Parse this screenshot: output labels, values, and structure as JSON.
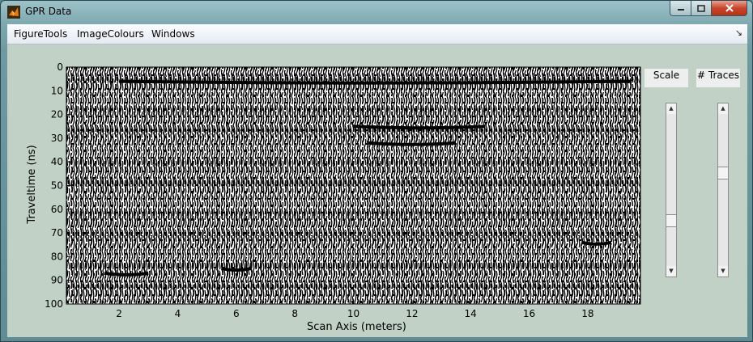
{
  "window": {
    "title": "GPR Data",
    "icon": "matlab-logo-icon",
    "controls": {
      "minimize": "minimize-icon",
      "maximize": "maximize-icon",
      "close": "close-icon"
    }
  },
  "menu": {
    "items": [
      "FigureTools",
      "ImageColours",
      "Windows"
    ],
    "dock_icon": "↘"
  },
  "controls": {
    "scale": {
      "label": "Scale",
      "value_fraction": 0.28
    },
    "traces": {
      "label": "# Traces",
      "value_fraction": 0.62
    }
  },
  "chart_data": {
    "type": "heatmap",
    "title": "",
    "xlabel": "Scan Axis (meters)",
    "ylabel": "Traveltime (ns)",
    "xlim": [
      0.2,
      19.8
    ],
    "ylim": [
      100,
      0
    ],
    "xticks": [
      2,
      4,
      6,
      8,
      10,
      12,
      14,
      16,
      18
    ],
    "yticks": [
      0,
      10,
      20,
      30,
      40,
      50,
      60,
      70,
      80,
      90,
      100
    ],
    "colormap": "binary black/white wiggle",
    "strong_reflectors": [
      {
        "from_x": 2.0,
        "to_x": 19.5,
        "y": 6
      },
      {
        "from_x": 10.0,
        "to_x": 14.5,
        "y": 25
      },
      {
        "from_x": 10.5,
        "to_x": 13.5,
        "y": 32
      },
      {
        "from_x": 1.5,
        "to_x": 3.0,
        "y": 87
      },
      {
        "from_x": 5.5,
        "to_x": 6.5,
        "y": 85
      },
      {
        "from_x": 17.8,
        "to_x": 18.8,
        "y": 74
      }
    ]
  }
}
